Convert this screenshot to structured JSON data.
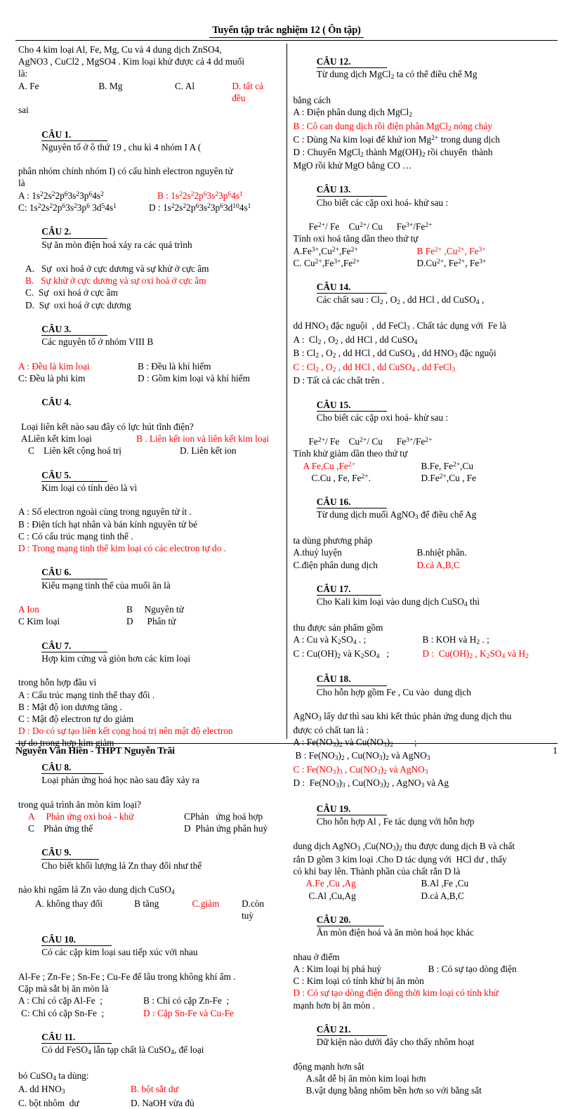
{
  "header": {
    "title": "Tuyển tập trắc nghiệm 12 ( Ôn tập)"
  },
  "footer": {
    "author": "Nguyễn Văn Hiền - THPT Nguyễn Trãi",
    "page_number": "1"
  },
  "left_column": {
    "intro": {
      "l1": "Cho 4 kim loại Al, Fe, Mg, Cu và 4 dung dịch ZnSO4,",
      "l2": "AgNO3 , CuCl2 , MgSO4 . Kim loại khử được cả 4 dd muối",
      "l3": "là:",
      "l4_a": "A. Fe",
      "l4_b": "B. Mg",
      "l4_c": "C. Al",
      "l4_d": "D. tất cả đều",
      "l5": "sai"
    },
    "q1": {
      "num": "CÂU 1.",
      "stem1": "Nguyên tố ở ô thứ 19 , chu kì 4 nhóm I A (",
      "stem2": "phân nhóm chính nhóm I) có cấu hình electron nguyên tử",
      "stem3": "là",
      "a": "A : 1s22s22p63s23p64s2",
      "b": "B : 1s22s22p63s23p64s1",
      "c": "C: 1s22s22p63s23p6 3d54s1",
      "d": "D : 1s22s22p63s23p63d104s1",
      "answer": "B"
    },
    "q2": {
      "num": "CÂU 2.",
      "stem": "Sự ăn mòn điện hoá xảy ra các quá trình",
      "a": "A.   Sự  oxi hoá ở cực dương và sự khử ở cực âm",
      "b": "B.   Sự khử ở cực dương và sự oxi hoá ở cực âm",
      "c": "C.  Sự  oxi hoá ở cực âm",
      "d": "D.  Sự  oxi hoá ở cực dương",
      "answer": "B"
    },
    "q3": {
      "num": "CÂU 3.",
      "stem": "Các nguyên tố ở nhóm VIII B",
      "a": "A : Đều là kim loại",
      "b": "B : Đều là khí hiếm",
      "c": "C: Đều là phi kim",
      "d": "D : Gồm kim loại và khí hiếm",
      "answer": "A"
    },
    "q4": {
      "num": "CÂU 4.",
      "stem": "Loại liên kết nào sau đây có lực hút tĩnh điện?",
      "a": "ALiên kết kim loại",
      "b": "B . Liên kết ion và liên kết kim loại",
      "c": "C    Liên kết cộng hoá trị",
      "d": "D. Liên kết ion",
      "answer": "B"
    },
    "q5": {
      "num": "CÂU 5.",
      "stem": "Kim loại có tính dẻo là vì",
      "a": "A : Số electron ngoài cùng trong nguyên tử ít .",
      "b": "B : Điện tích hạt nhân và bán kính nguyên tử bé",
      "c": "C : Có cấu trúc mạng tinh thể .",
      "d": "D : Trong mạng tinh thể kim loại có các electron tự do .",
      "answer": "D"
    },
    "q6": {
      "num": "CÂU 6.",
      "stem": "Kiểu mạng tinh thể của muối ăn là",
      "a": "A Ion",
      "b": "B     Nguyên tử",
      "c": "C Kim loại",
      "d": "D      Phân tử",
      "answer": "A"
    },
    "q7": {
      "num": "CÂU 7.",
      "stem1": "Hợp kim cứng và giòn hơn các kim loại",
      "stem2": "trong hỗn hợp đầu vì",
      "a": "A : Cấu trúc mạng tinh thể thay đổi .",
      "b": "B : Mật độ ion dương tăng .",
      "c": "C : Mật độ electron tự do giảm",
      "d1": "D : Do có sự tạo liên kết cọng hoá trị nên mật độ electron",
      "d2": "tự do trong hợp kim giảm",
      "answer": "D"
    },
    "q8": {
      "num": "CÂU 8.",
      "stem1": "Loại phản ứng hoá học nào sau đây xảy ra",
      "stem2": "trong quá trình ăn mòn kim loại?",
      "a": "A     Phản ứng oxi hoá - khử",
      "b": "CPhản   ứng hoá hợp",
      "c": "C    Phản ứng thế",
      "d": "D  Phản ứng phân huỷ",
      "answer": "A"
    },
    "q9": {
      "num": "CÂU 9.",
      "stem1": "Cho biết khối lượng lá Zn thay đổi như thế",
      "stem2": "nào khi ngâm lá Zn vào dung dịch CuSO4",
      "a": "A. không thay đổi",
      "b": "B tăng",
      "c": "C.giảm",
      "d": "D.còn tuỳ",
      "answer": "C"
    },
    "q10": {
      "num": "CÂU 10.",
      "stem1": "Có các cặp kim loại sau tiếp xúc với nhau",
      "stem2": "Al-Fe ; Zn-Fe ; Sn-Fe ; Cu-Fe để lâu trong không khí ẩm .",
      "stem3": "Cặp mà sắt bị ăn mòn là",
      "a": "A : Chỉ có cặp Al-Fe  ;",
      "b": "B : Chỉ có cặp Zn-Fe  ;",
      "c": "C: Chỉ có cặp Sn-Fe  ;",
      "d": "D : Cặp Sn-Fe và Cu-Fe",
      "answer": "D"
    },
    "q11": {
      "num": "CÂU 11.",
      "stem1": "Có dd FeSO4 lẫn tạp chất là CuSO4, để loại",
      "stem2": "bỏ CuSO4 ta dùng:",
      "a": "A. dd HNO3",
      "b": "B. bột sắt dư",
      "c": "C. bột nhôm  dư",
      "d": "D. NaOH vừa đủ",
      "answer": "B"
    }
  },
  "right_column": {
    "q12": {
      "num": "CÂU 12.",
      "stem1": "Từ dung dịch MgCl2 ta có thể điều chế Mg",
      "stem2": "bằng cách",
      "a": "A : Điện phân dung dịch MgCl2",
      "b": "B : Cô can dung dịch rồi điện phân MgCl2 nóng chảy",
      "c": "C : Dùng Na kim loại để khử ion Mg2+ trong dung dịch",
      "d1": "D : Chuyển MgCl2 thành Mg(OH)2 rồi chuyển  thành",
      "d2": "MgO rồi khử MgO bằng CO …",
      "answer": "B"
    },
    "q13": {
      "num": "CÂU 13.",
      "stem1": "Cho biết các cặp oxi hoá- khử sau :",
      "stem2": "Fe2+/ Fe      Cu2+/ Cu          Fe3+/Fe2+",
      "stem3": "Tính oxi hoá tăng dần theo thứ tự",
      "a": "A.Fe3+,Cu2+,Fe2+",
      "b": "B Fe2+ ,Cu2+, Fe3+",
      "c": "C. Cu2+,Fe3+,Fe2+",
      "d": "D.Cu2+, Fe2+, Fe3+",
      "answer": "B"
    },
    "q14": {
      "num": "CÂU 14.",
      "stem1": "Các chất sau : Cl2 , O2 , dd HCl , dd CuSO4 ,",
      "stem2": "dd HNO3 đặc nguội  , dd FeCl3 . Chất tác dụng với Fe là",
      "a": "A :  Cl2 , O2 , dd HCl , dd CuSO4",
      "b": "B : Cl2 , O2 , dd HCl , dd CuSO4 , dd HNO3 đặc nguội",
      "c": "C : Cl2 , O2 , dd HCl , dd CuSO4 , dd FeCl3",
      "d": "D : Tất cả các chất trên .",
      "answer": "C"
    },
    "q15": {
      "num": "CÂU 15.",
      "stem1": "Cho biết các cặp oxi hoá- khử sau :",
      "stem2": "Fe2+/ Fe      Cu2+/ Cu          Fe3+/Fe2+",
      "stem3": "Tính khử giảm dần theo thứ tự",
      "a": "A Fe,Cu ,Fe2+",
      "b": "B.Fe, Fe2+,Cu",
      "c": "C.Cu , Fe, Fe2+.",
      "d": "D.Fe2+,Cu , Fe",
      "answer": "A"
    },
    "q16": {
      "num": "CÂU 16.",
      "stem1": "Từ dung dịch muối AgNO3 để điều chế Ag",
      "stem2": "ta dùng phương pháp",
      "a": "A.thuỷ luyện",
      "b": "B.nhiệt phân.",
      "c": "C.điện phân dung dịch",
      "d": "D.cả A,B,C",
      "answer": "D"
    },
    "q17": {
      "num": "CÂU 17.",
      "stem1": "Cho Kali kim loại vào dung dịch CuSO4 thì",
      "stem2": "thu được sản phẩm gồm",
      "a": "A : Cu và K2SO4 . ;",
      "b": "B : KOH và H2 . ;",
      "c": "C : Cu(OH)2 và K2SO4   ;",
      "d": "D :  Cu(OH)2 , K2SO4 và H2",
      "answer": "D"
    },
    "q18": {
      "num": "CÂU 18.",
      "stem1": "Cho hỗn hợp gồm Fe , Cu vào  dung dịch",
      "stem2": "AgNO3 lấy dư thì sau khi kết thúc phản ứng dung dịch thu",
      "stem3": "được có chất tan là :",
      "a": "A : Fe(NO3)2 và Cu(NO3)2          ;",
      "b": "B : Fe(NO3)2 , Cu(NO3)2 và AgNO3",
      "c": "C : Fe(NO3)3 , Cu(NO3)2 và AgNO3",
      "d": "D :  Fe(NO3)3 , Cu(NO3)2 , AgNO3 và Ag",
      "answer": "C"
    },
    "q19": {
      "num": "CÂU 19.",
      "stem1": "Cho hỗn hợp Al , Fe tác dụng với hỗn hợp",
      "stem2": "dung dịch AgNO3 ,Cu(NO3)2 thu được dung dịch B và chất",
      "stem3": "rắn D gồm 3 kim loại .Cho D tác dụng với  HCl dư , thấy",
      "stem4": "có khí bay lên. Thành phần của chất rắn D là",
      "a": "A.Fe ,Cu ,Ag",
      "b": "B.Al ,Fe ,Cu",
      "c": "C.Al ,Cu,Ag",
      "d": "D.cả A,B,C",
      "answer": "A"
    },
    "q20": {
      "num": "CÂU 20.",
      "stem1": "Ăn mòn điện hoá và ăn mòn hoá học khác",
      "stem2": "nhau ở điểm",
      "a": "A : Kim loại bị phá huỷ",
      "b": "B : Có sự tạo dòng điện",
      "c": "C : Kim loại có tính khử bị ăn mòn",
      "d1": "D : Có sự tạo dòng điện đồng thời kim loại có tính khử",
      "d2": "mạnh hơn bị ăn mòn .",
      "answer": "D"
    },
    "q21": {
      "num": "CÂU 21.",
      "stem1": "Dữ kiện nào dưới đây cho thấy nhôm hoạt",
      "stem2": "động mạnh hơn sắt",
      "a": "A.sắt dễ bị ăn mòn kim loại hơn",
      "b": "B.vật dụng bằng nhôm bền hơn so với bằng sắt"
    }
  }
}
